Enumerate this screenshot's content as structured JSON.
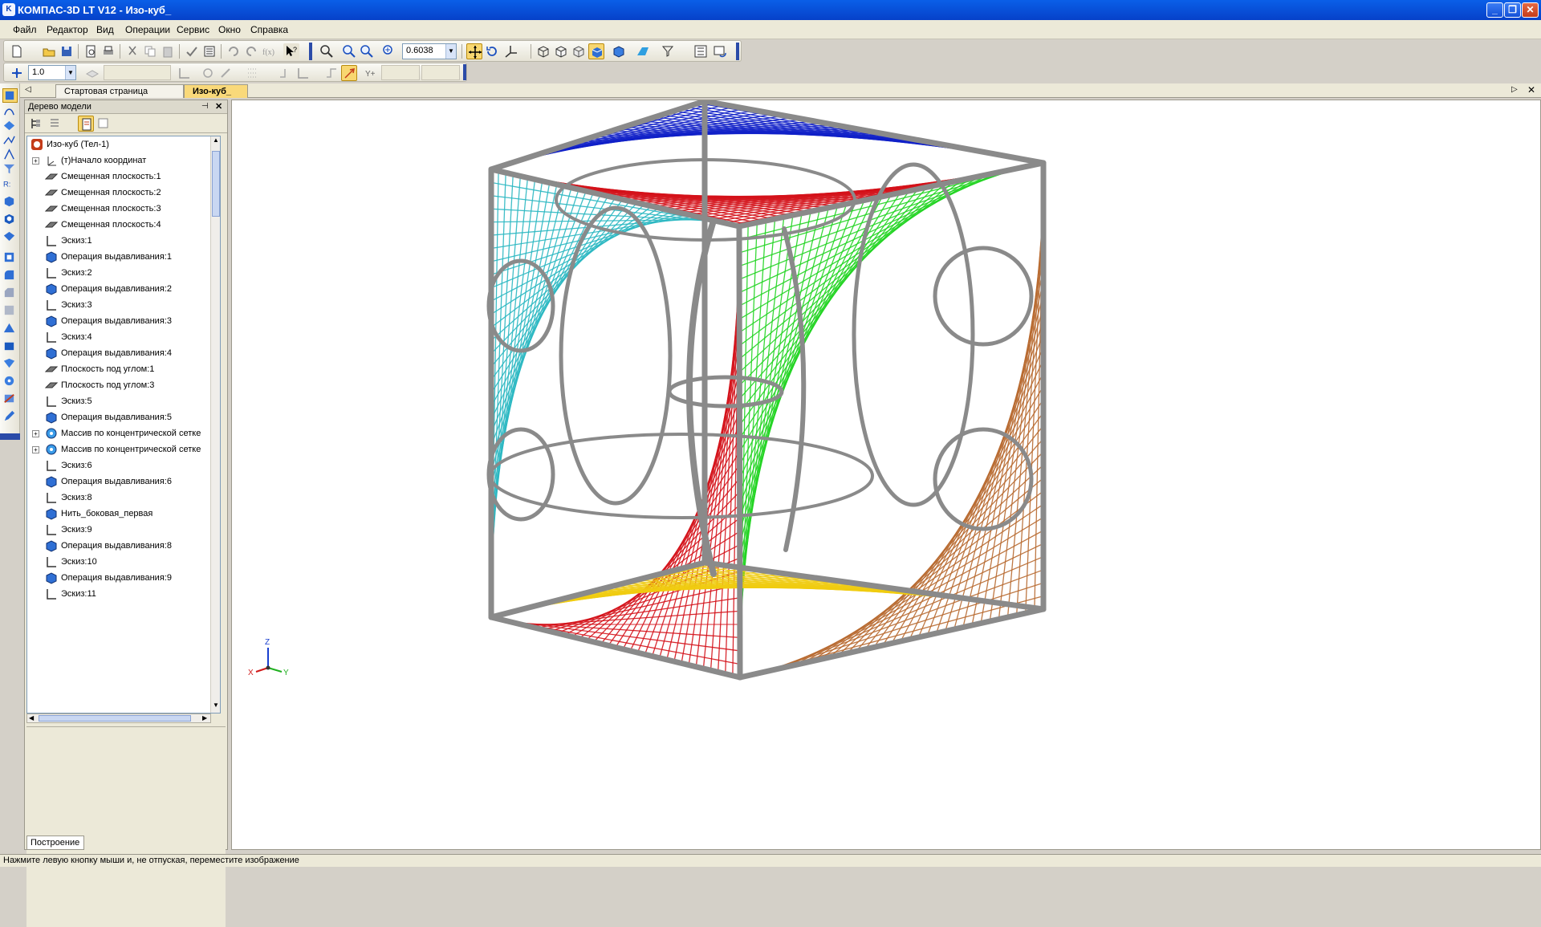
{
  "window": {
    "title": "КОМПАС-3D LT V12 - Изо-куб_",
    "app_icon": "kompas-icon",
    "controls": [
      "minimize",
      "restore",
      "close"
    ]
  },
  "menu": [
    "Файл",
    "Редактор",
    "Вид",
    "Операции",
    "Сервис",
    "Окно",
    "Справка"
  ],
  "toolbar": {
    "zoom_value": "0.6038",
    "step_value": "1.0",
    "accent": "#0a5fe8"
  },
  "tabs": {
    "start": "Стартовая страница",
    "active": "Изо-куб_"
  },
  "tree": {
    "header": "Дерево модели",
    "root": "Изо-куб (Тел-1)",
    "items": [
      {
        "label": "(т)Начало координат",
        "icon": "origin-icon",
        "expandable": true
      },
      {
        "label": "Смещенная плоскость:1",
        "icon": "plane-icon"
      },
      {
        "label": "Смещенная плоскость:2",
        "icon": "plane-icon"
      },
      {
        "label": "Смещенная плоскость:3",
        "icon": "plane-icon"
      },
      {
        "label": "Смещенная плоскость:4",
        "icon": "plane-icon"
      },
      {
        "label": "Эскиз:1",
        "icon": "sketch-icon"
      },
      {
        "label": "Операция выдавливания:1",
        "icon": "extrude-icon"
      },
      {
        "label": "Эскиз:2",
        "icon": "sketch-icon"
      },
      {
        "label": "Операция выдавливания:2",
        "icon": "extrude-icon"
      },
      {
        "label": "Эскиз:3",
        "icon": "sketch-icon"
      },
      {
        "label": "Операция выдавливания:3",
        "icon": "extrude-icon"
      },
      {
        "label": "Эскиз:4",
        "icon": "sketch-icon"
      },
      {
        "label": "Операция выдавливания:4",
        "icon": "extrude-icon"
      },
      {
        "label": "Плоскость под углом:1",
        "icon": "plane-icon"
      },
      {
        "label": "Плоскость под углом:3",
        "icon": "plane-icon"
      },
      {
        "label": "Эскиз:5",
        "icon": "sketch-icon"
      },
      {
        "label": "Операция выдавливания:5",
        "icon": "extrude-icon"
      },
      {
        "label": "Массив по концентрической сетке",
        "icon": "array-icon",
        "expandable": true
      },
      {
        "label": "Массив по концентрической сетке",
        "icon": "array-icon",
        "expandable": true
      },
      {
        "label": "Эскиз:6",
        "icon": "sketch-icon"
      },
      {
        "label": "Операция выдавливания:6",
        "icon": "extrude-icon"
      },
      {
        "label": "Эскиз:8",
        "icon": "sketch-icon"
      },
      {
        "label": "Нить_боковая_первая",
        "icon": "extrude-icon"
      },
      {
        "label": "Эскиз:9",
        "icon": "sketch-icon"
      },
      {
        "label": "Операция выдавливания:8",
        "icon": "extrude-icon"
      },
      {
        "label": "Эскиз:10",
        "icon": "sketch-icon"
      },
      {
        "label": "Операция выдавливания:9",
        "icon": "extrude-icon"
      },
      {
        "label": "Эскиз:11",
        "icon": "sketch-icon"
      }
    ],
    "footer_tab": "Построение"
  },
  "axes": {
    "x": "X",
    "y": "Y",
    "z": "Z"
  },
  "colors": {
    "frame": "#8a8a8a",
    "red": "#d4121a",
    "cyan": "#2bb8c2",
    "blue": "#1020c8",
    "green": "#22d422",
    "brown": "#b86a30",
    "yellow": "#f0cc10"
  },
  "status": "Нажмите левую кнопку мыши и, не отпуская, переместите изображение"
}
